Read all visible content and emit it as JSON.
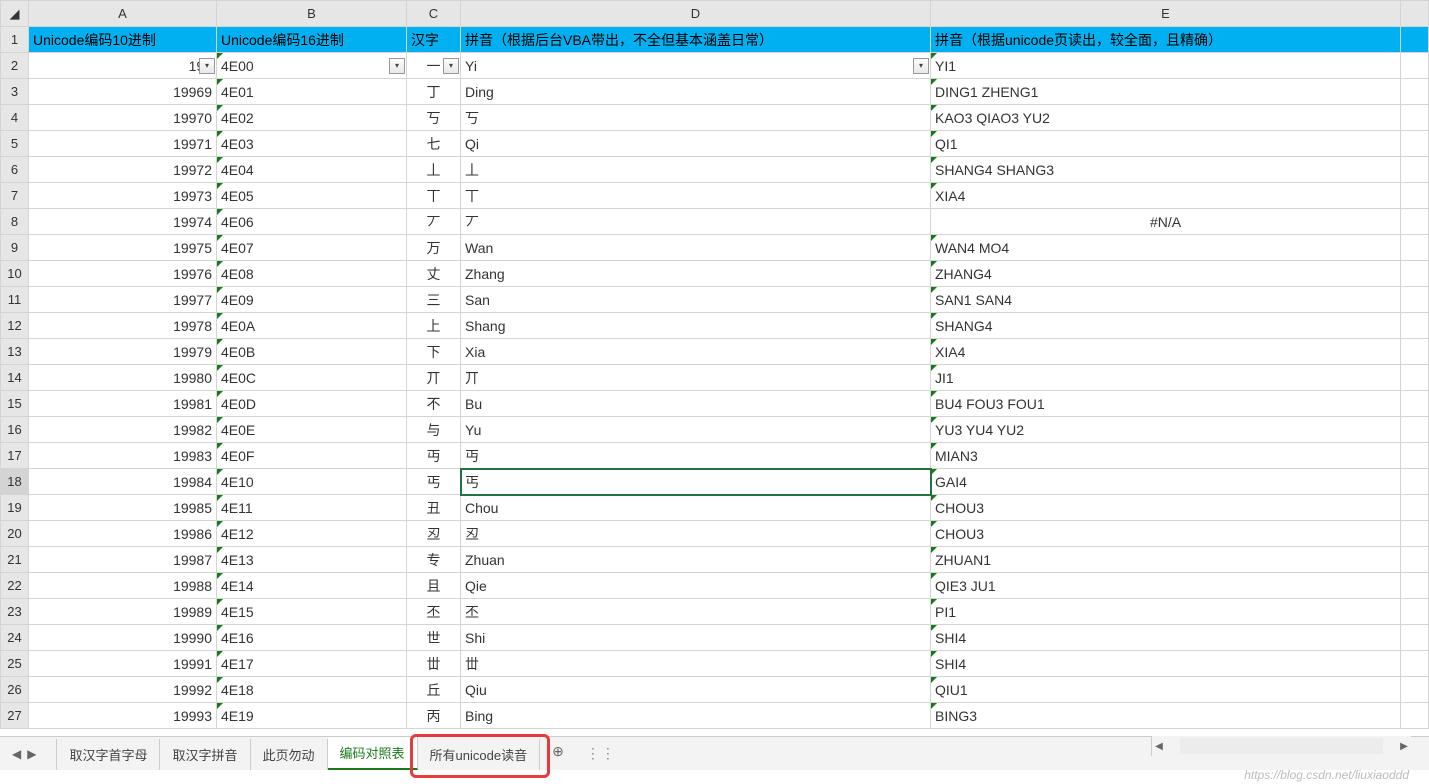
{
  "columns": [
    "A",
    "B",
    "C",
    "D",
    "E"
  ],
  "headerRow": {
    "A": "Unicode编码10进制",
    "B": "Unicode编码16进制",
    "C": "汉字",
    "D": "拼音（根据后台VBA带出，不全但基本涵盖日常）",
    "E": "拼音（根据unicode页读出，较全面，且精确）"
  },
  "selected": {
    "row": 18,
    "col": "D"
  },
  "rows": [
    {
      "n": 2,
      "A": "199",
      "A_filter": true,
      "B": "4E00",
      "B_filter": true,
      "C": "一",
      "C_filter": true,
      "D": "Yi",
      "D_filter": true,
      "E": "YI1"
    },
    {
      "n": 3,
      "A": "19969",
      "B": "4E01",
      "C": "丁",
      "D": "Ding",
      "E": "DING1 ZHENG1"
    },
    {
      "n": 4,
      "A": "19970",
      "B": "4E02",
      "C": "丂",
      "D": "丂",
      "E": "KAO3 QIAO3 YU2"
    },
    {
      "n": 5,
      "A": "19971",
      "B": "4E03",
      "C": "七",
      "D": "Qi",
      "E": "QI1"
    },
    {
      "n": 6,
      "A": "19972",
      "B": "4E04",
      "C": "丄",
      "D": "丄",
      "E": "SHANG4 SHANG3"
    },
    {
      "n": 7,
      "A": "19973",
      "B": "4E05",
      "C": "丅",
      "D": "丅",
      "E": "XIA4"
    },
    {
      "n": 8,
      "A": "19974",
      "B": "4E06",
      "C": "丆",
      "D": "丆",
      "E": "#N/A",
      "E_center": true
    },
    {
      "n": 9,
      "A": "19975",
      "B": "4E07",
      "C": "万",
      "D": "Wan",
      "E": "WAN4 MO4"
    },
    {
      "n": 10,
      "A": "19976",
      "B": "4E08",
      "C": "丈",
      "D": "Zhang",
      "E": "ZHANG4"
    },
    {
      "n": 11,
      "A": "19977",
      "B": "4E09",
      "C": "三",
      "D": "San",
      "E": "SAN1 SAN4"
    },
    {
      "n": 12,
      "A": "19978",
      "B": "4E0A",
      "C": "上",
      "D": "Shang",
      "E": "SHANG4"
    },
    {
      "n": 13,
      "A": "19979",
      "B": "4E0B",
      "C": "下",
      "D": "Xia",
      "E": "XIA4"
    },
    {
      "n": 14,
      "A": "19980",
      "B": "4E0C",
      "C": "丌",
      "D": "丌",
      "E": "JI1"
    },
    {
      "n": 15,
      "A": "19981",
      "B": "4E0D",
      "C": "不",
      "D": "Bu",
      "E": "BU4 FOU3 FOU1"
    },
    {
      "n": 16,
      "A": "19982",
      "B": "4E0E",
      "C": "与",
      "D": "Yu",
      "E": "YU3 YU4 YU2"
    },
    {
      "n": 17,
      "A": "19983",
      "B": "4E0F",
      "C": "丏",
      "D": "丏",
      "E": "MIAN3"
    },
    {
      "n": 18,
      "A": "19984",
      "B": "4E10",
      "C": "丐",
      "D": "丐",
      "E": "GAI4"
    },
    {
      "n": 19,
      "A": "19985",
      "B": "4E11",
      "C": "丑",
      "D": "Chou",
      "E": "CHOU3"
    },
    {
      "n": 20,
      "A": "19986",
      "B": "4E12",
      "C": "丒",
      "D": "丒",
      "E": "CHOU3"
    },
    {
      "n": 21,
      "A": "19987",
      "B": "4E13",
      "C": "专",
      "D": "Zhuan",
      "E": "ZHUAN1"
    },
    {
      "n": 22,
      "A": "19988",
      "B": "4E14",
      "C": "且",
      "D": "Qie",
      "E": "QIE3 JU1"
    },
    {
      "n": 23,
      "A": "19989",
      "B": "4E15",
      "C": "丕",
      "D": "丕",
      "E": "PI1"
    },
    {
      "n": 24,
      "A": "19990",
      "B": "4E16",
      "C": "世",
      "D": "Shi",
      "E": "SHI4"
    },
    {
      "n": 25,
      "A": "19991",
      "B": "4E17",
      "C": "丗",
      "D": "丗",
      "E": "SHI4"
    },
    {
      "n": 26,
      "A": "19992",
      "B": "4E18",
      "C": "丘",
      "D": "Qiu",
      "E": "QIU1"
    },
    {
      "n": 27,
      "A": "19993",
      "B": "4E19",
      "C": "丙",
      "D": "Bing",
      "E": "BING3"
    }
  ],
  "tabs": [
    {
      "label": "取汉字首字母",
      "active": false
    },
    {
      "label": "取汉字拼音",
      "active": false
    },
    {
      "label": "此页勿动",
      "active": false
    },
    {
      "label": "编码对照表",
      "active": true
    },
    {
      "label": "所有unicode读音",
      "active": false
    }
  ],
  "tabnav": {
    "first": "|◀",
    "prev": "◀",
    "next": "▶",
    "last": "▶|"
  },
  "addTabGlyph": "⊕",
  "watermark": "https://blog.csdn.net/liuxiaoddd"
}
